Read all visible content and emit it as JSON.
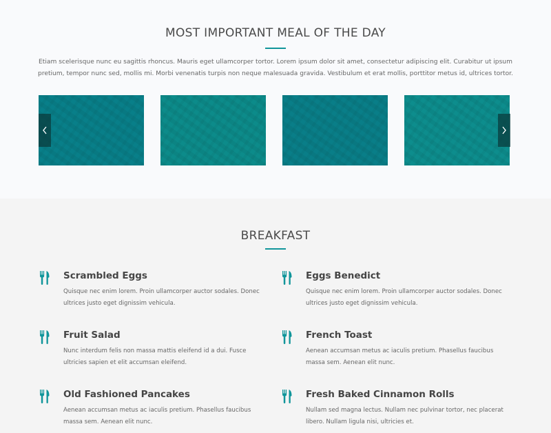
{
  "top": {
    "title": "MOST IMPORTANT MEAL OF THE DAY",
    "intro": "Etiam scelerisque nunc eu sagittis rhoncus. Mauris eget ullamcorper tortor. Lorem ipsum dolor sit amet, consectetur adipiscing elit. Curabitur ut ipsum pretium, tempor nunc sed, mollis mi. Morbi venenatis turpis non neque malesuada gravida. Vestibulum et erat mollis, porttitor metus id, ultrices tortor."
  },
  "slider": {
    "prev_icon": "chevron-left-icon",
    "next_icon": "chevron-right-icon",
    "slide_count": 4
  },
  "breakfast": {
    "title": "BREAKFAST",
    "item_icon": "fork-knife-icon",
    "items": [
      {
        "name": "Scrambled Eggs",
        "desc": "Quisque nec enim lorem. Proin ullamcorper auctor sodales. Donec ultrices justo eget dignissim vehicula."
      },
      {
        "name": "Eggs Benedict",
        "desc": "Quisque nec enim lorem. Proin ullamcorper auctor sodales. Donec ultrices justo eget dignissim vehicula."
      },
      {
        "name": "Fruit Salad",
        "desc": "Nunc interdum felis non massa mattis eleifend id a dui. Fusce ultricies sapien et elit accumsan eleifend."
      },
      {
        "name": "French Toast",
        "desc": "Aenean accumsan metus ac iaculis pretium. Phasellus faucibus massa sem. Aenean elit nunc."
      },
      {
        "name": "Old Fashioned Pancakes",
        "desc": "Aenean accumsan metus ac iaculis pretium. Phasellus faucibus massa sem. Aenean elit nunc."
      },
      {
        "name": "Fresh Baked Cinnamon Rolls",
        "desc": "Nullam sed magna lectus. Nullam nec pulvinar tortor, nec placerat libero. Nullam ligula nisi, ultricies et."
      }
    ]
  },
  "colors": {
    "accent": "#10959a",
    "slide_teal": "#0b8a8f",
    "section_bg_top": "#f9fafc",
    "section_bg_bottom": "#f4f4f4"
  }
}
